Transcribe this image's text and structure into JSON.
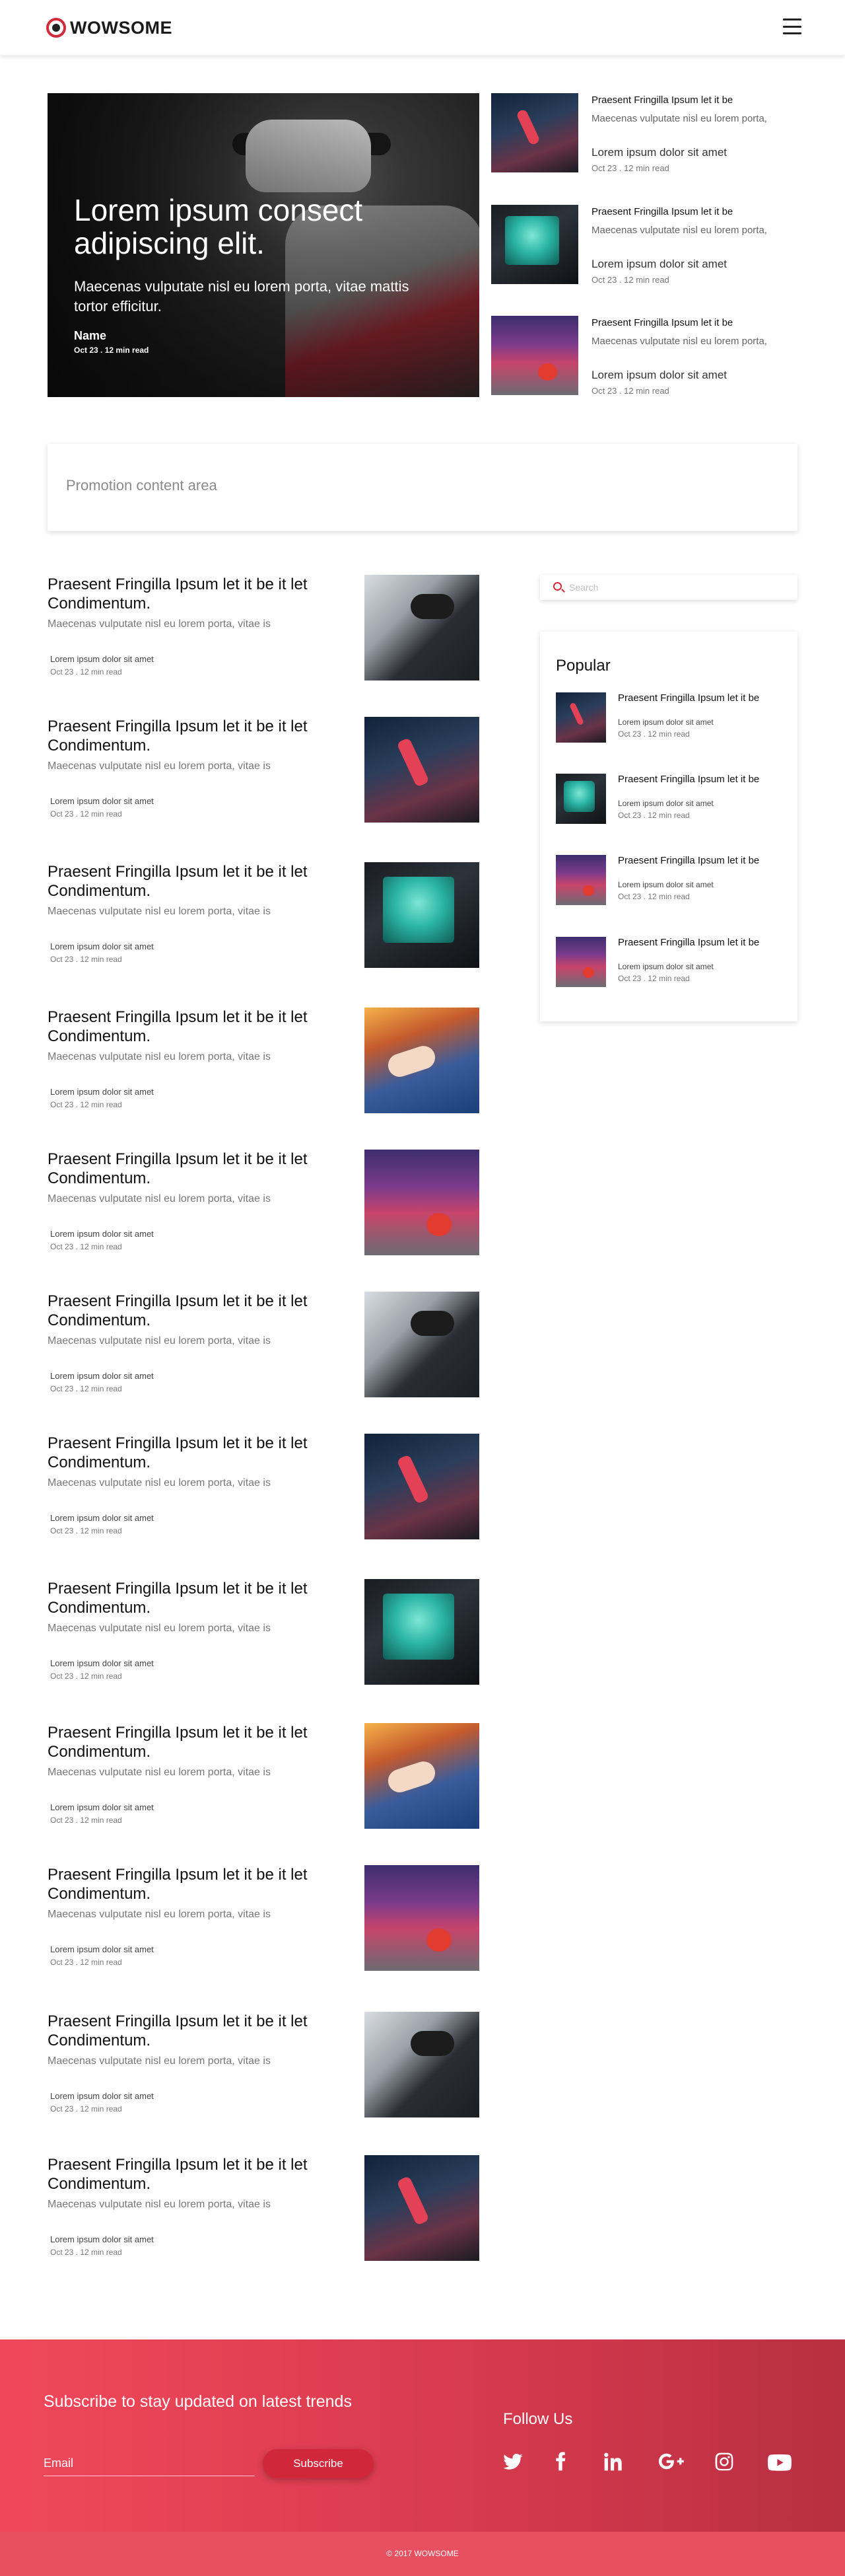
{
  "header": {
    "logo_text": "WOWSOME",
    "menu_icon": "hamburger-menu-icon"
  },
  "hero": {
    "title": "Lorem ipsum consect adipiscing elit.",
    "subtitle": "Maecenas vulputate nisl eu lorem porta, vitae mattis tortor efficitur.",
    "author": "Name",
    "meta": "Oct 23 . 12 min read"
  },
  "featured": [
    {
      "title": "Praesent Fringilla Ipsum let it be",
      "desc": "Maecenas vulputate nisl eu lorem porta,",
      "sub": "Lorem ipsum dolor sit amet",
      "meta": "Oct 23 . 12 min read"
    },
    {
      "title": "Praesent Fringilla Ipsum let it be",
      "desc": "Maecenas vulputate nisl eu lorem porta,",
      "sub": "Lorem ipsum dolor sit amet",
      "meta": "Oct 23 . 12 min read"
    },
    {
      "title": "Praesent Fringilla Ipsum let it be",
      "desc": "Maecenas vulputate nisl eu lorem porta,",
      "sub": "Lorem ipsum dolor sit amet",
      "meta": "Oct 23 . 12 min read"
    }
  ],
  "promo": {
    "text": "Promotion content area"
  },
  "articles": [
    {
      "title": "Praesent Fringilla Ipsum let it be it let Condimentum.",
      "desc": "Maecenas vulputate nisl eu lorem porta, vitae is",
      "sub": "Lorem ipsum dolor sit amet",
      "meta": "Oct 23 . 12 min read"
    },
    {
      "title": "Praesent Fringilla Ipsum let it be it let Condimentum.",
      "desc": "Maecenas vulputate nisl eu lorem porta, vitae is",
      "sub": "Lorem ipsum dolor sit amet",
      "meta": "Oct 23 . 12 min read"
    },
    {
      "title": "Praesent Fringilla Ipsum let it be it let Condimentum.",
      "desc": "Maecenas vulputate nisl eu lorem porta, vitae is",
      "sub": "Lorem ipsum dolor sit amet",
      "meta": "Oct 23 . 12 min read"
    },
    {
      "title": "Praesent Fringilla Ipsum let it be it let Condimentum.",
      "desc": "Maecenas vulputate nisl eu lorem porta, vitae is",
      "sub": "Lorem ipsum dolor sit amet",
      "meta": "Oct 23 . 12 min read"
    },
    {
      "title": "Praesent Fringilla Ipsum let it be it let Condimentum.",
      "desc": "Maecenas vulputate nisl eu lorem porta, vitae is",
      "sub": "Lorem ipsum dolor sit amet",
      "meta": "Oct 23 . 12 min read"
    },
    {
      "title": "Praesent Fringilla Ipsum let it be it let Condimentum.",
      "desc": "Maecenas vulputate nisl eu lorem porta, vitae is",
      "sub": "Lorem ipsum dolor sit amet",
      "meta": "Oct 23 . 12 min read"
    },
    {
      "title": "Praesent Fringilla Ipsum let it be it let Condimentum.",
      "desc": "Maecenas vulputate nisl eu lorem porta, vitae is",
      "sub": "Lorem ipsum dolor sit amet",
      "meta": "Oct 23 . 12 min read"
    },
    {
      "title": "Praesent Fringilla Ipsum let it be it let Condimentum.",
      "desc": "Maecenas vulputate nisl eu lorem porta, vitae is",
      "sub": "Lorem ipsum dolor sit amet",
      "meta": "Oct 23 . 12 min read"
    },
    {
      "title": "Praesent Fringilla Ipsum let it be it let Condimentum.",
      "desc": "Maecenas vulputate nisl eu lorem porta, vitae is",
      "sub": "Lorem ipsum dolor sit amet",
      "meta": "Oct 23 . 12 min read"
    },
    {
      "title": "Praesent Fringilla Ipsum let it be it let Condimentum.",
      "desc": "Maecenas vulputate nisl eu lorem porta, vitae is",
      "sub": "Lorem ipsum dolor sit amet",
      "meta": "Oct 23 . 12 min read"
    },
    {
      "title": "Praesent Fringilla Ipsum let it be it let Condimentum.",
      "desc": "Maecenas vulputate nisl eu lorem porta, vitae is",
      "sub": "Lorem ipsum dolor sit amet",
      "meta": "Oct 23 . 12 min read"
    },
    {
      "title": "Praesent Fringilla Ipsum let it be it let Condimentum.",
      "desc": "Maecenas vulputate nisl eu lorem porta, vitae is",
      "sub": "Lorem ipsum dolor sit amet",
      "meta": "Oct 23 . 12 min read"
    }
  ],
  "search": {
    "placeholder": "Search",
    "icon": "search-icon"
  },
  "popular": {
    "title": "Popular",
    "items": [
      {
        "title": "Praesent Fringilla Ipsum let it be",
        "sub": "Lorem ipsum dolor sit amet",
        "meta": "Oct 23 . 12 min read"
      },
      {
        "title": "Praesent Fringilla Ipsum let it be",
        "sub": "Lorem ipsum dolor sit amet",
        "meta": "Oct 23 . 12 min read"
      },
      {
        "title": "Praesent Fringilla Ipsum let it be",
        "sub": "Lorem ipsum dolor sit amet",
        "meta": "Oct 23 . 12 min read"
      },
      {
        "title": "Praesent Fringilla Ipsum let it be",
        "sub": "Lorem ipsum dolor sit amet",
        "meta": "Oct 23 . 12 min read"
      }
    ]
  },
  "footer": {
    "subscribe_title": "Subscribe to stay updated on latest trends",
    "email_label": "Email",
    "subscribe_button": "Subscribe",
    "follow_title": "Follow Us",
    "social_icons": [
      "twitter-icon",
      "facebook-icon",
      "linkedin-icon",
      "google-plus-icon",
      "instagram-icon",
      "youtube-icon"
    ],
    "copyright": "© 2017 WOWSOME"
  },
  "colors": {
    "brand_red": "#d12a3a",
    "footer_gradient_start": "#f0485a",
    "footer_gradient_end": "#b82f42"
  }
}
